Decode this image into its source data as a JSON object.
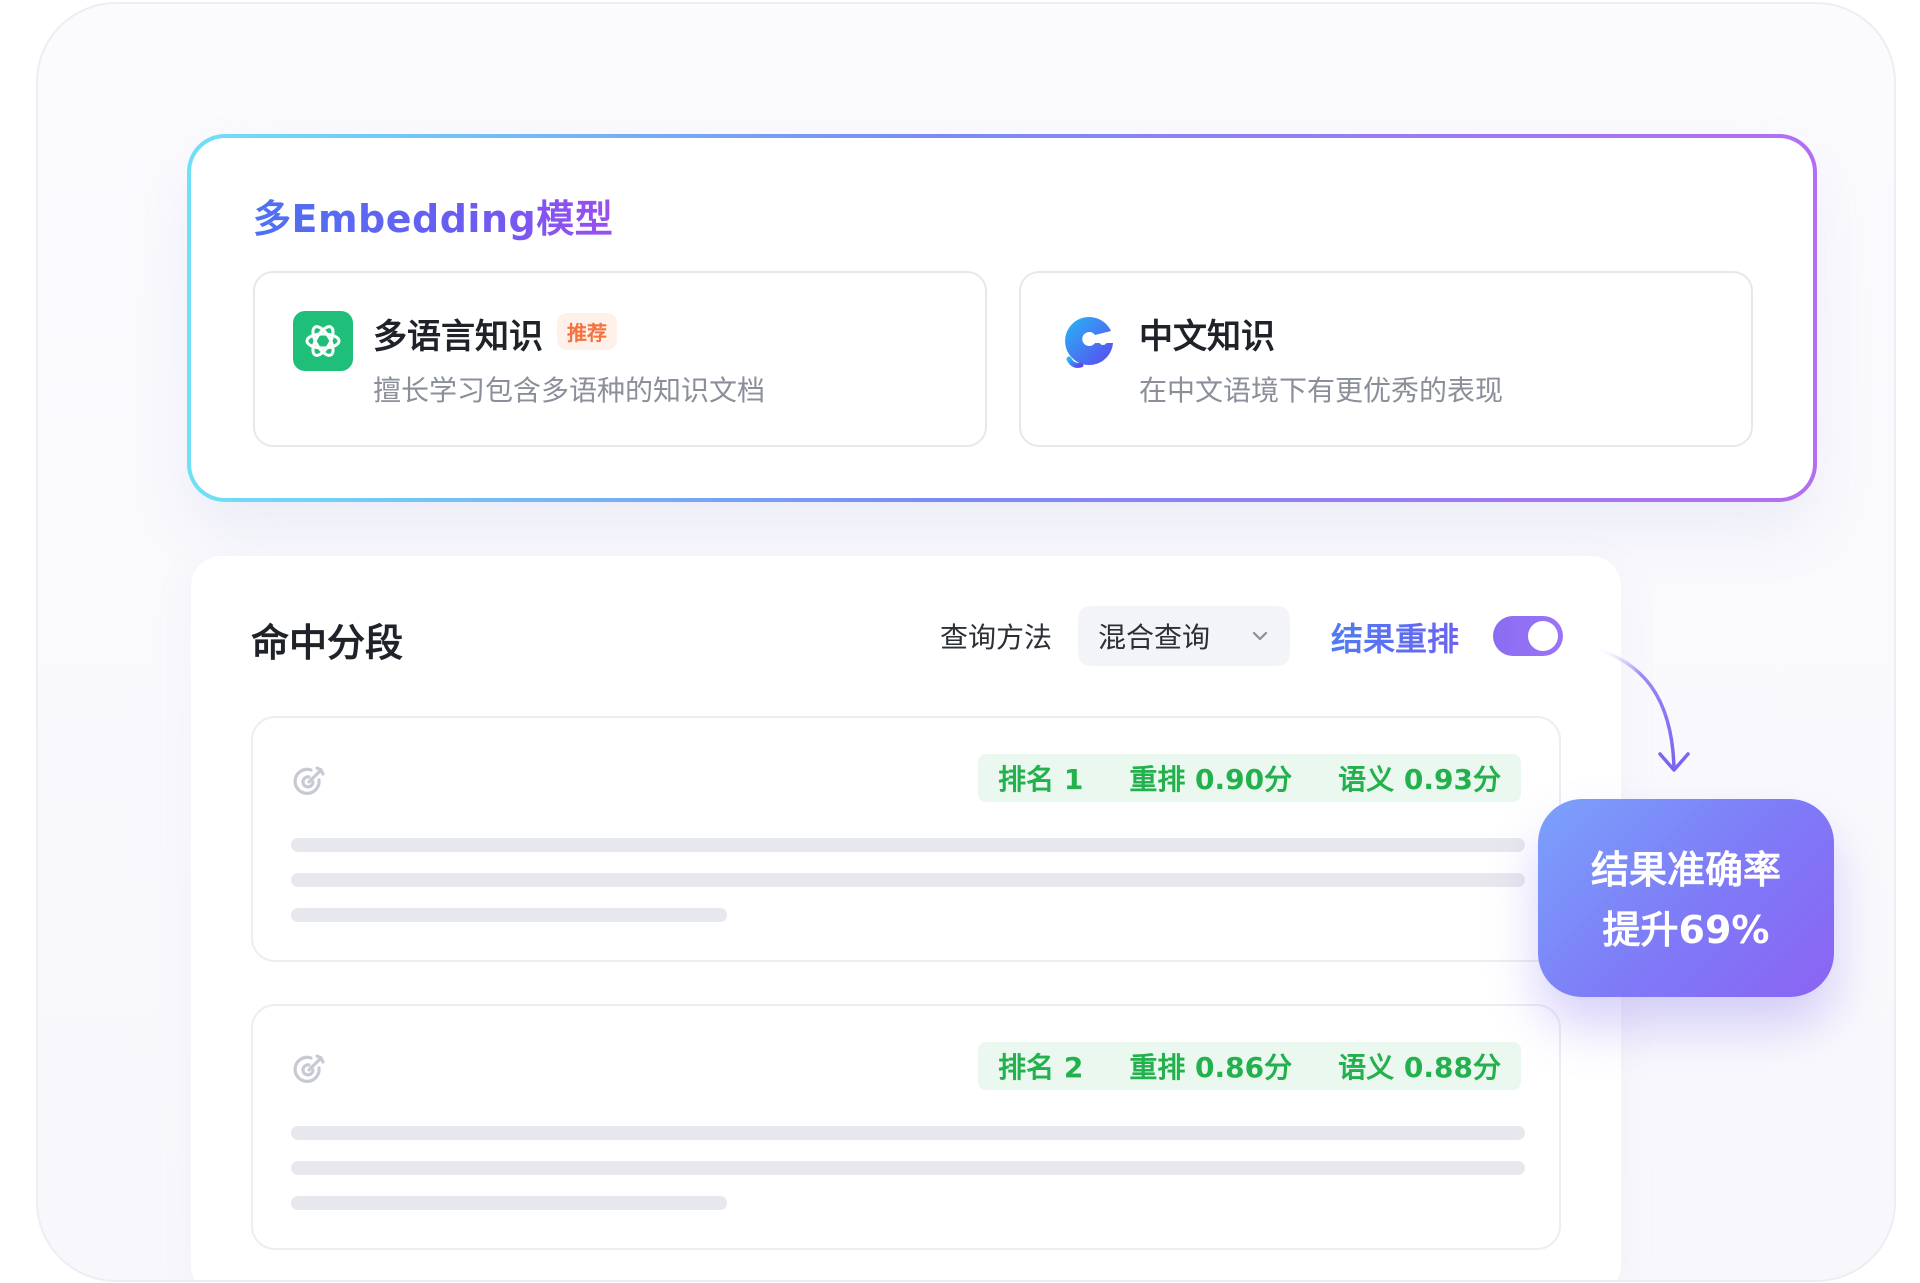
{
  "embedding": {
    "title": "多Embedding模型",
    "models": [
      {
        "name": "多语言知识",
        "badge": "推荐",
        "description": "擅长学习包含多语种的知识文档",
        "icon": "openai-icon"
      },
      {
        "name": "中文知识",
        "description": "在中文语境下有更优秀的表现",
        "icon": "chinese-model-icon"
      }
    ]
  },
  "hits": {
    "title": "命中分段",
    "query_method_label": "查询方法",
    "query_method_value": "混合查询",
    "rerank_label": "结果重排",
    "rerank_enabled": true,
    "items": [
      {
        "rank": "排名 1",
        "rerank": "重排 0.90分",
        "semantic": "语义 0.93分"
      },
      {
        "rank": "排名 2",
        "rerank": "重排 0.86分",
        "semantic": "语义 0.88分"
      }
    ]
  },
  "callout": {
    "line1": "结果准确率",
    "line2": "提升69%"
  },
  "colors": {
    "accent_purple": "#8a6df3",
    "score_green": "#22b14c",
    "badge_orange": "#f5713d"
  }
}
